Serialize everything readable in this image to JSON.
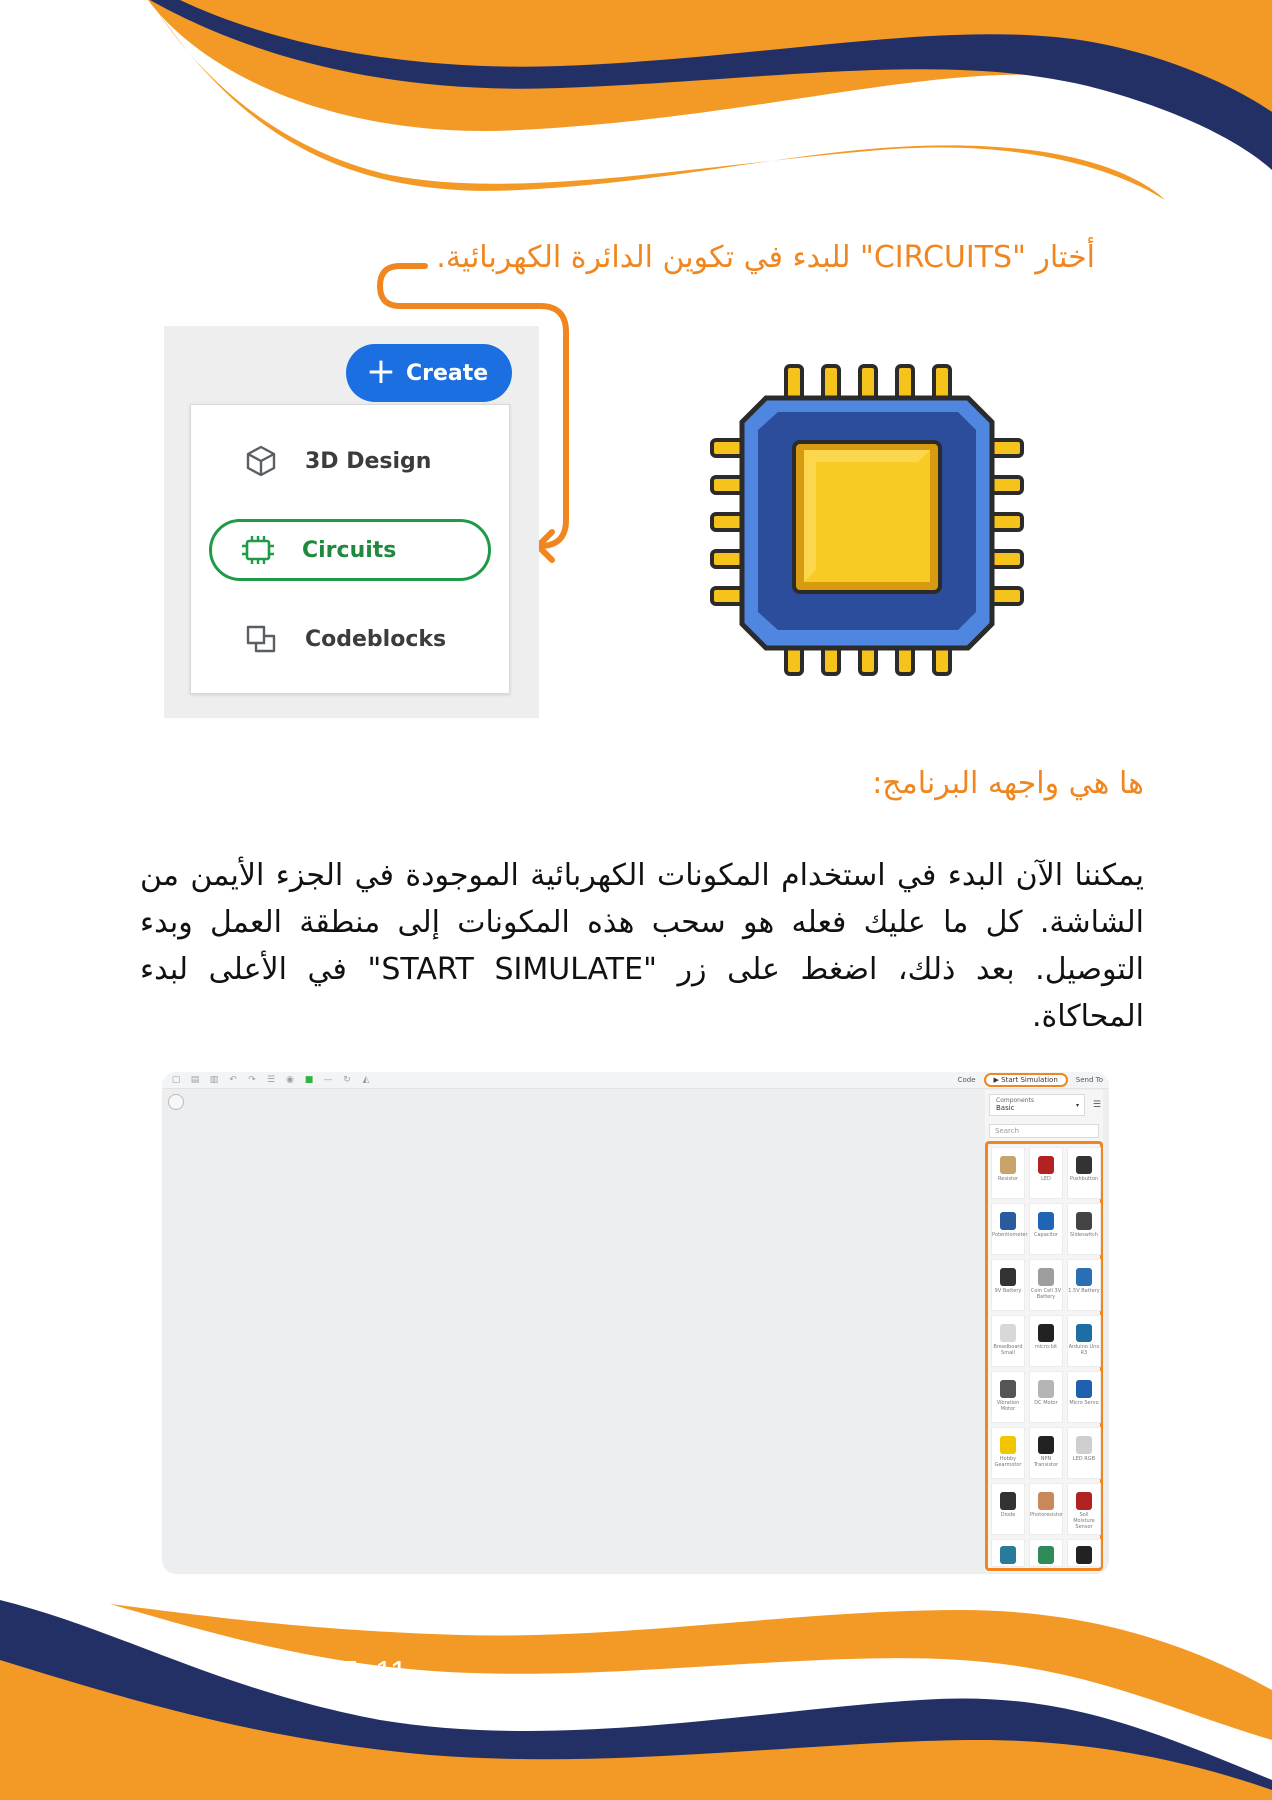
{
  "colors": {
    "orange": "#f0861f",
    "navy": "#233066",
    "green": "#1f9a47",
    "blue": "#1b6fe0"
  },
  "instruction": "أختار \"CIRCUITS\" للبدء في تكوين الدائرة الكهربائية.",
  "menu": {
    "create_label": "Create",
    "items": [
      {
        "label": "3D Design",
        "icon": "cube-icon"
      },
      {
        "label": "Circuits",
        "icon": "chip-icon",
        "selected": true
      },
      {
        "label": "Codeblocks",
        "icon": "codeblocks-icon"
      }
    ]
  },
  "chip_illustration": "chip-icon",
  "heading": "ها هي واجهه البرنامج:",
  "body": "يمكننا الآن البدء في استخدام المكونات الكهربائية الموجودة في الجزء الأيمن من الشاشة. كل ما عليك فعله هو سحب هذه المكونات إلى منطقة العمل وبدء التوصيل. بعد ذلك، اضغط على زر \"START SIMULATE\" في الأعلى لبدء المحاكاة.",
  "screenshot": {
    "toolbar_right": {
      "code": "Code",
      "start_simulation": "Start Simulation",
      "send_to": "Send To"
    },
    "panel": {
      "dropdown_label": "Components",
      "dropdown_value": "Basic",
      "search_placeholder": "Search",
      "components": [
        {
          "name": "Resistor",
          "color": "#c9a36b"
        },
        {
          "name": "LED",
          "color": "#b22222"
        },
        {
          "name": "Pushbutton",
          "color": "#333333"
        },
        {
          "name": "Potentiometer",
          "color": "#2a5b9e"
        },
        {
          "name": "Capacitor",
          "color": "#1f64b5"
        },
        {
          "name": "Slideswitch",
          "color": "#444444"
        },
        {
          "name": "9V Battery",
          "color": "#333333"
        },
        {
          "name": "Coin Cell 3V Battery",
          "color": "#9e9e9e"
        },
        {
          "name": "1.5V Battery",
          "color": "#2b6fb3"
        },
        {
          "name": "Breadboard Small",
          "color": "#d8d8d8"
        },
        {
          "name": "micro:bit",
          "color": "#222222"
        },
        {
          "name": "Arduino Uno R3",
          "color": "#1c6ea4"
        },
        {
          "name": "Vibration Motor",
          "color": "#555555"
        },
        {
          "name": "DC Motor",
          "color": "#b5b5b5"
        },
        {
          "name": "Micro Servo",
          "color": "#1e5fb0"
        },
        {
          "name": "Hobby Gearmotor",
          "color": "#f2c500"
        },
        {
          "name": "NPN Transistor",
          "color": "#222222"
        },
        {
          "name": "LED RGB",
          "color": "#cfcfcf"
        },
        {
          "name": "Diode",
          "color": "#333333"
        },
        {
          "name": "Photoresistor",
          "color": "#c9885a"
        },
        {
          "name": "Soil Moisture Sensor",
          "color": "#b22222"
        },
        {
          "name": "",
          "color": "#2a7a9a"
        },
        {
          "name": "",
          "color": "#2e8b57"
        },
        {
          "name": "",
          "color": "#222222"
        }
      ]
    }
  },
  "page_label": "PAGE: 11"
}
